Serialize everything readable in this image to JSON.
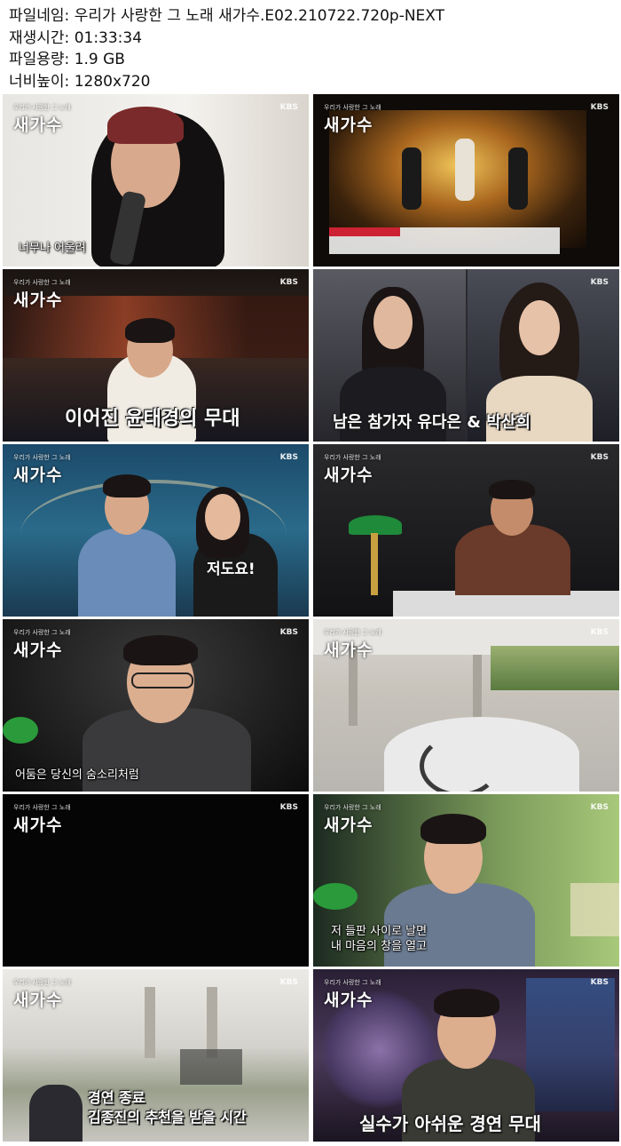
{
  "info": {
    "filename": "파일네임: 우리가 사랑한 그 노래 새가수.E02.210722.720p-NEXT",
    "duration": "재생시간: 01:33:34",
    "filesize": "파일용량: 1.9 GB",
    "resolution": "너비높이: 1280x720"
  },
  "thumbs": [
    {
      "sub": "너무나 어울려"
    },
    {
      "sub": ""
    },
    {
      "caption": "이어진 윤태경의 무대"
    },
    {
      "caption": "남은 참가자 유다은 & 박산희"
    },
    {
      "caption": "저도요!"
    },
    {
      "sub": ""
    },
    {
      "sub": "어둠은 당신의 숨소리처럼"
    },
    {
      "sub": ""
    },
    {
      "sub": ""
    },
    {
      "sub_line1": "저 들판 사이로 날면",
      "sub_line2": "내 마음의 창을 열고"
    },
    {
      "caption_line1": "경연 종료",
      "caption_line2": "김종진의 추천을 받을 시간"
    },
    {
      "caption": "실수가 아쉬운 경연 무대"
    }
  ],
  "brand": {
    "logo": "새가수",
    "network": "KBS"
  }
}
